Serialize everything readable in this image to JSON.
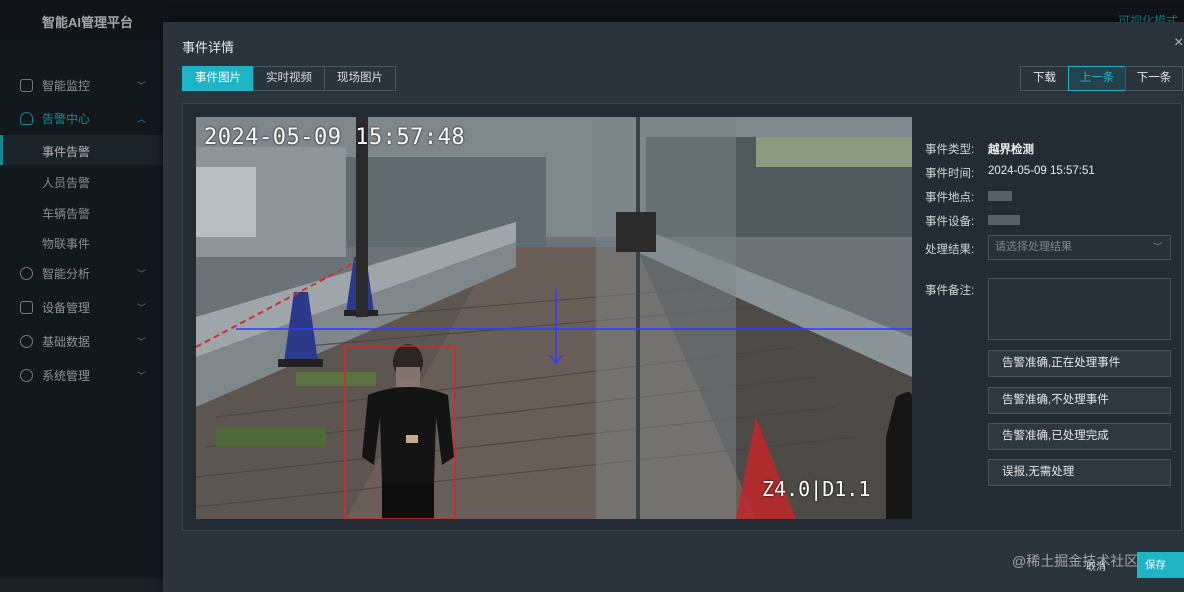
{
  "app": {
    "title": "智能AI管理平台",
    "top_right": "可视化模式"
  },
  "sidebar": {
    "items": [
      {
        "label": "智能监控",
        "icon": "monitor-icon"
      },
      {
        "label": "告警中心",
        "icon": "bell-icon"
      },
      {
        "label": "智能分析",
        "icon": "analysis-icon"
      },
      {
        "label": "设备管理",
        "icon": "camera-icon"
      },
      {
        "label": "基础数据",
        "icon": "compass-icon"
      },
      {
        "label": "系统管理",
        "icon": "gear-icon"
      }
    ],
    "subitems": [
      "事件告警",
      "人员告警",
      "车辆告警",
      "物联事件"
    ]
  },
  "modal": {
    "title": "事件详情",
    "close": "×",
    "tabs": [
      "事件图片",
      "实时视频",
      "现场图片"
    ],
    "actions": [
      "下载",
      "上一条",
      "下一条"
    ],
    "photo": {
      "timestamp": "2024-05-09 15:57:48",
      "zoom": "Z4.0|D1.1"
    },
    "fields": {
      "type_label": "事件类型:",
      "type_value": "越界检测",
      "time_label": "事件时间:",
      "time_value": "2024-05-09 15:57:51",
      "location_label": "事件地点:",
      "device_label": "事件设备:",
      "result_label": "处理结果:",
      "result_placeholder": "请选择处理结果",
      "remark_label": "事件备注:"
    },
    "options": [
      "告警准确,正在处理事件",
      "告警准确,不处理事件",
      "告警准确,已处理完成",
      "误报,无需处理"
    ]
  },
  "footer": {
    "cancel": "取消",
    "confirm": "保存",
    "watermark": "@稀土掘金技术社区"
  },
  "colors": {
    "accent": "#1fb3c6",
    "detect_box": "#e02424",
    "boundary_line": "#2f3cff"
  }
}
